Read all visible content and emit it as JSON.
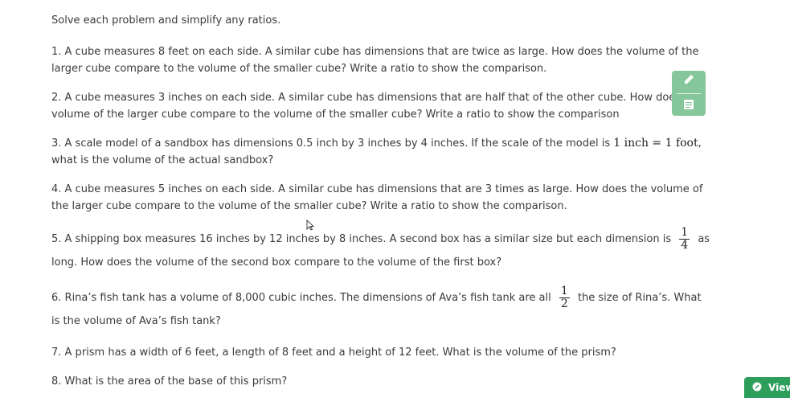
{
  "intro": "Solve each problem and simplify any ratios.",
  "problems": [
    {
      "text": "1. A cube measures 8 feet on each side. A similar cube has dimensions that are twice as large. How does the volume of the larger cube compare to the volume of the smaller cube? Write a ratio to show the comparison."
    },
    {
      "text": "2. A cube measures 3 inches on each side. A similar cube has dimensions that are half that of the other cube. How does the volume of the larger cube compare to the volume of the smaller cube? Write a ratio to show the comparison"
    },
    {
      "before": "3. A scale model of a sandbox has dimensions 0.5 inch by 3 inches by 4 inches. If the scale of the model is",
      "math": "1 inch = 1 foot",
      "after": ", what is the volume of the actual sandbox?"
    },
    {
      "text": "4. A cube measures 5 inches on each side. A similar cube has dimensions that are 3 times as large. How does the volume of the larger cube compare to the volume of the smaller cube? Write a ratio to show the comparison."
    },
    {
      "before": "5. A shipping box measures 16 inches by 12 inches by 8 inches. A second box has a similar size but each dimension is",
      "frac_num": "1",
      "frac_den": "4",
      "after": "as long. How does the volume of the second box compare to the volume of the first box?"
    },
    {
      "before": "6. Rina’s fish tank has a volume of 8,000 cubic inches. The dimensions of Ava’s fish tank are all",
      "frac_num": "1",
      "frac_den": "2",
      "after": "the size of Rina’s. What is the volume of Ava’s fish tank?"
    },
    {
      "text": "7. A prism has a width of 6 feet, a length of 8 feet and a height of 12 feet. What is the volume of the prism?"
    },
    {
      "text": "8. What is the area of the base of this prism?"
    }
  ],
  "tools": {
    "pencil_icon": "pencil-icon",
    "notes_icon": "notes-icon"
  },
  "view_button": {
    "label": "View",
    "icon": "leaf-icon"
  },
  "colors": {
    "tool_bg": "#85c79a",
    "view_bg": "#2e9e5b"
  }
}
